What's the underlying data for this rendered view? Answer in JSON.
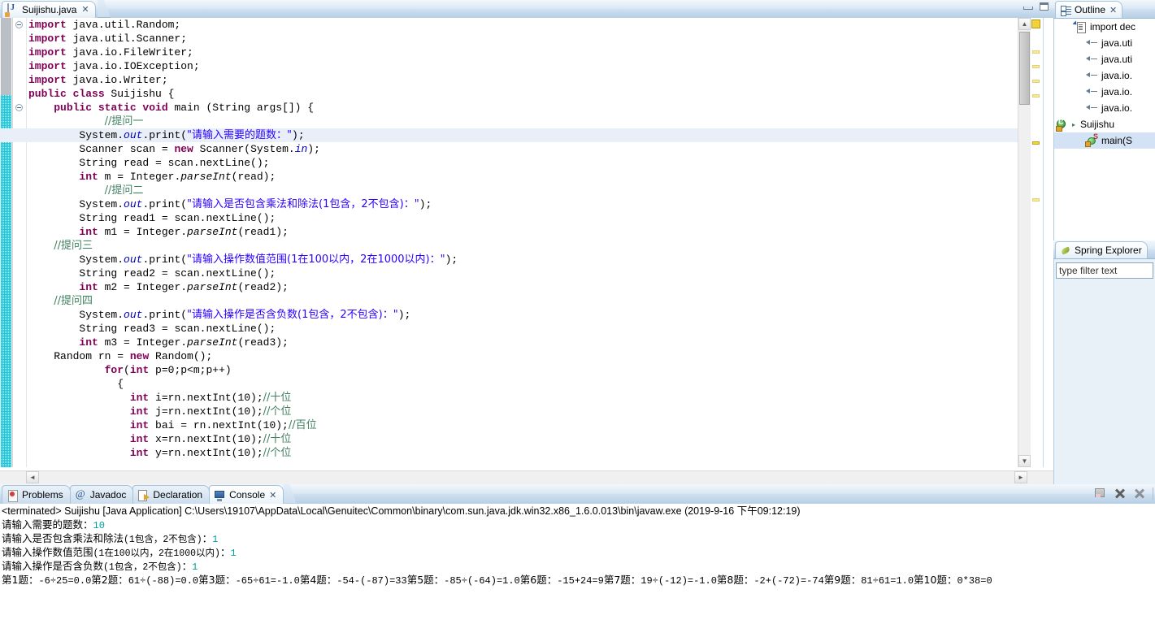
{
  "window": {
    "minimize_label": "Minimize",
    "maximize_label": "Maximize"
  },
  "editor": {
    "tab": {
      "label": "Suijishu.java",
      "close": "✕",
      "icon": "java-file-icon"
    },
    "code_lines": [
      {
        "indent": 0,
        "fold": true,
        "tokens": [
          {
            "t": "import",
            "c": "kw"
          },
          {
            "t": " java.util.Random;",
            "c": ""
          }
        ]
      },
      {
        "indent": 0,
        "tokens": [
          {
            "t": "import",
            "c": "kw"
          },
          {
            "t": " java.util.Scanner;",
            "c": ""
          }
        ]
      },
      {
        "indent": 0,
        "tokens": [
          {
            "t": "import",
            "c": "kw"
          },
          {
            "t": " java.io.FileWriter;",
            "c": ""
          }
        ]
      },
      {
        "indent": 0,
        "tokens": [
          {
            "t": "import",
            "c": "kw"
          },
          {
            "t": " java.io.IOException;",
            "c": ""
          }
        ]
      },
      {
        "indent": 0,
        "tokens": [
          {
            "t": "import",
            "c": "kw"
          },
          {
            "t": " java.io.Writer;",
            "c": ""
          }
        ]
      },
      {
        "indent": 0,
        "tokens": [
          {
            "t": "public class",
            "c": "kw"
          },
          {
            "t": " Suijishu {",
            "c": ""
          }
        ]
      },
      {
        "indent": 1,
        "fold": true,
        "tokens": [
          {
            "t": "public static void",
            "c": "kw"
          },
          {
            "t": " main (String args[]) {",
            "c": ""
          }
        ]
      },
      {
        "indent": 3,
        "tokens": [
          {
            "t": "//提问一",
            "c": "cmt"
          }
        ]
      },
      {
        "indent": 2,
        "current": true,
        "tokens": [
          {
            "t": "System.",
            "c": ""
          },
          {
            "t": "out",
            "c": "fld"
          },
          {
            "t": ".print(",
            "c": ""
          },
          {
            "t": "\"请输入需要的题数：\"",
            "c": "str"
          },
          {
            "t": ");",
            "c": ""
          }
        ]
      },
      {
        "indent": 2,
        "tokens": [
          {
            "t": "Scanner scan = ",
            "c": ""
          },
          {
            "t": "new",
            "c": "kw"
          },
          {
            "t": " Scanner(System.",
            "c": ""
          },
          {
            "t": "in",
            "c": "fld"
          },
          {
            "t": ");",
            "c": ""
          }
        ]
      },
      {
        "indent": 2,
        "tokens": [
          {
            "t": "String read = scan.nextLine();",
            "c": ""
          }
        ]
      },
      {
        "indent": 2,
        "tokens": [
          {
            "t": "int",
            "c": "kw"
          },
          {
            "t": " m = Integer.",
            "c": ""
          },
          {
            "t": "parseInt",
            "c": "stc"
          },
          {
            "t": "(read);",
            "c": ""
          }
        ]
      },
      {
        "indent": 3,
        "tokens": [
          {
            "t": "//提问二",
            "c": "cmt"
          }
        ]
      },
      {
        "indent": 2,
        "tokens": [
          {
            "t": "System.",
            "c": ""
          },
          {
            "t": "out",
            "c": "fld"
          },
          {
            "t": ".print(",
            "c": ""
          },
          {
            "t": "\"请输入是否包含乘法和除法(1包含，2不包含)：\"",
            "c": "str"
          },
          {
            "t": ");",
            "c": ""
          }
        ]
      },
      {
        "indent": 2,
        "tokens": [
          {
            "t": "String read1 = scan.nextLine();",
            "c": ""
          }
        ]
      },
      {
        "indent": 2,
        "tokens": [
          {
            "t": "int",
            "c": "kw"
          },
          {
            "t": " m1 = Integer.",
            "c": ""
          },
          {
            "t": "parseInt",
            "c": "stc"
          },
          {
            "t": "(read1);",
            "c": ""
          }
        ]
      },
      {
        "indent": 1,
        "tokens": [
          {
            "t": "//提问三",
            "c": "cmt"
          }
        ]
      },
      {
        "indent": 2,
        "tokens": [
          {
            "t": "System.",
            "c": ""
          },
          {
            "t": "out",
            "c": "fld"
          },
          {
            "t": ".print(",
            "c": ""
          },
          {
            "t": "\"请输入操作数值范围(1在100以内，2在1000以内)：\"",
            "c": "str"
          },
          {
            "t": ");",
            "c": ""
          }
        ]
      },
      {
        "indent": 2,
        "tokens": [
          {
            "t": "String read2 = scan.nextLine();",
            "c": ""
          }
        ]
      },
      {
        "indent": 2,
        "tokens": [
          {
            "t": "int",
            "c": "kw"
          },
          {
            "t": " m2 = Integer.",
            "c": ""
          },
          {
            "t": "parseInt",
            "c": "stc"
          },
          {
            "t": "(read2);",
            "c": ""
          }
        ]
      },
      {
        "indent": 1,
        "tokens": [
          {
            "t": "//提问四",
            "c": "cmt"
          }
        ]
      },
      {
        "indent": 2,
        "tokens": [
          {
            "t": "System.",
            "c": ""
          },
          {
            "t": "out",
            "c": "fld"
          },
          {
            "t": ".print(",
            "c": ""
          },
          {
            "t": "\"请输入操作是否含负数(1包含，2不包含)：\"",
            "c": "str"
          },
          {
            "t": ");",
            "c": ""
          }
        ]
      },
      {
        "indent": 2,
        "tokens": [
          {
            "t": "String read3 = scan.nextLine();",
            "c": ""
          }
        ]
      },
      {
        "indent": 2,
        "tokens": [
          {
            "t": "int",
            "c": "kw"
          },
          {
            "t": " m3 = Integer.",
            "c": ""
          },
          {
            "t": "parseInt",
            "c": "stc"
          },
          {
            "t": "(read3);",
            "c": ""
          }
        ]
      },
      {
        "indent": 1,
        "tokens": [
          {
            "t": "Random rn = ",
            "c": ""
          },
          {
            "t": "new",
            "c": "kw"
          },
          {
            "t": " Random();",
            "c": ""
          }
        ]
      },
      {
        "indent": 3,
        "tokens": [
          {
            "t": "for",
            "c": "kw"
          },
          {
            "t": "(",
            "c": ""
          },
          {
            "t": "int",
            "c": "kw"
          },
          {
            "t": " p=0;p<m;p++)",
            "c": ""
          }
        ]
      },
      {
        "indent": 3,
        "tokens": [
          {
            "t": "  {",
            "c": ""
          }
        ]
      },
      {
        "indent": 4,
        "tokens": [
          {
            "t": "int",
            "c": "kw"
          },
          {
            "t": " i=rn.nextInt(10);",
            "c": ""
          },
          {
            "t": "//十位",
            "c": "cmt"
          }
        ]
      },
      {
        "indent": 4,
        "tokens": [
          {
            "t": "int",
            "c": "kw"
          },
          {
            "t": " j=rn.nextInt(10);",
            "c": ""
          },
          {
            "t": "//个位",
            "c": "cmt"
          }
        ]
      },
      {
        "indent": 4,
        "tokens": [
          {
            "t": "int",
            "c": "kw"
          },
          {
            "t": " bai = rn.nextInt(10);",
            "c": ""
          },
          {
            "t": "//百位",
            "c": "cmt"
          }
        ]
      },
      {
        "indent": 4,
        "tokens": [
          {
            "t": "int",
            "c": "kw"
          },
          {
            "t": " x=rn.nextInt(10);",
            "c": ""
          },
          {
            "t": "//十位",
            "c": "cmt"
          }
        ]
      },
      {
        "indent": 4,
        "tokens": [
          {
            "t": "int",
            "c": "kw"
          },
          {
            "t": " y=rn.nextInt(10);",
            "c": ""
          },
          {
            "t": "//个位",
            "c": "cmt"
          }
        ]
      }
    ],
    "scrollbar": {
      "up_arrow": "▲",
      "down_arrow": "▼",
      "left_arrow": "◄",
      "right_arrow": "►"
    }
  },
  "outline": {
    "tab_label": "Outline",
    "tab_close": "✕",
    "items": [
      {
        "label": "import dec",
        "icon": "imports-icon",
        "indent": 1
      },
      {
        "label": "java.uti",
        "icon": "import-icon",
        "indent": 2
      },
      {
        "label": "java.uti",
        "icon": "import-icon",
        "indent": 2
      },
      {
        "label": "java.io.",
        "icon": "import-icon",
        "indent": 2
      },
      {
        "label": "java.io.",
        "icon": "import-icon",
        "indent": 2
      },
      {
        "label": "java.io.",
        "icon": "import-icon",
        "indent": 2
      },
      {
        "label": "Suijishu",
        "icon": "class-icon",
        "indent": 0
      },
      {
        "label": "main(S",
        "icon": "method-icon",
        "indent": 2,
        "selected": true
      }
    ]
  },
  "spring_explorer": {
    "tab_label": "Spring Explorer",
    "filter_placeholder": "type filter text",
    "filter_value": "type filter text"
  },
  "console": {
    "tabs": [
      {
        "label": "Problems",
        "icon": "problems-icon",
        "active": false,
        "closeable": false
      },
      {
        "label": "Javadoc",
        "icon": "javadoc-icon",
        "active": false,
        "closeable": false
      },
      {
        "label": "Declaration",
        "icon": "declaration-icon",
        "active": false,
        "closeable": false
      },
      {
        "label": "Console",
        "icon": "console-icon",
        "active": true,
        "closeable": true,
        "close": "✕"
      }
    ],
    "toolbar": [
      {
        "name": "clear-console-button",
        "title": "Clear Console"
      },
      {
        "name": "terminate-button",
        "title": "Terminate"
      },
      {
        "name": "remove-all-terminated-button",
        "title": "Remove All Terminated Launches"
      }
    ],
    "header": "<terminated> Suijishu [Java Application] C:\\Users\\19107\\AppData\\Local\\Genuitec\\Common\\binary\\com.sun.java.jdk.win32.x86_1.6.0.013\\bin\\javaw.exe (2019-9-16 下午09:12:19)",
    "prompts": [
      {
        "prompt": "请输入需要的题数：",
        "value": "10"
      },
      {
        "prompt": "请输入是否包含乘法和除法(1包含，2不包含)：",
        "value": "1"
      },
      {
        "prompt": "请输入操作数值范围(1在100以内，2在1000以内)：",
        "value": "1"
      },
      {
        "prompt": "请输入操作是否含负数(1包含，2不包含)：",
        "value": "1"
      }
    ],
    "results_line": "第1题：-6÷25=0.0第2题：61÷(-88)=0.0第3题：-65÷61=-1.0第4题：-54-(-87)=33第5题：-85÷(-64)=1.0第6题：-15+24=9第7题：19÷(-12)=-1.0第8题：-2+(-72)=-74第9题：81÷61=1.0第10题：0*38=0",
    "results": [
      {
        "n": "第1题：",
        "expr": "-6÷25=0.0"
      },
      {
        "n": "第2题：",
        "expr": "61÷(-88)=0.0"
      },
      {
        "n": "第3题：",
        "expr": "-65÷61=-1.0"
      },
      {
        "n": "第4题：",
        "expr": "-54-(-87)=33"
      },
      {
        "n": "第5题：",
        "expr": "-85÷(-64)=1.0"
      },
      {
        "n": "第6题：",
        "expr": "-15+24=9"
      },
      {
        "n": "第7题：",
        "expr": "19÷(-12)=-1.0"
      },
      {
        "n": "第8题：",
        "expr": "-2+(-72)=-74"
      },
      {
        "n": "第9题：",
        "expr": "81÷61=1.0"
      },
      {
        "n": "第10题：",
        "expr": "0*38=0"
      }
    ]
  },
  "colors": {
    "keyword": "#7f0055",
    "string": "#2a00ff",
    "comment": "#3f7f5f",
    "field": "#0000c0",
    "console_input": "#00a0a0",
    "tab_active": "#ffffff",
    "chrome": "#b6cfe6"
  }
}
